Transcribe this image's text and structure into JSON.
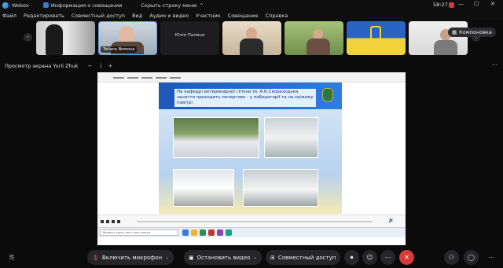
{
  "titlebar": {
    "app_name": "Webex",
    "meeting_info": "Информация о совещании",
    "hide_menu": "Скрыть строку меню",
    "timer": "58:27"
  },
  "menu": [
    "Файл",
    "Редактировать",
    "Совместный доступ",
    "Вид",
    "Аудио и видео",
    "Участник",
    "Совещание",
    "Справка"
  ],
  "participants": {
    "tiles": [
      {
        "name": ""
      },
      {
        "name": "Tetiana Nomova"
      },
      {
        "name": "Юлія Палиця"
      },
      {
        "name": ""
      },
      {
        "name": ""
      },
      {
        "name": ""
      },
      {
        "name": ""
      }
    ],
    "layout_button": "Компоновка"
  },
  "share": {
    "title": "Просмотр экрана Yurii Zhuk",
    "zoom_out": "−",
    "zoom_in": "+",
    "more": "···",
    "slide_text": "На кафедрі ветеринарної гігієни ім. А.К.Скороходька заняття проходить почергово - у лабораторії та на свіжому повітрі",
    "search_placeholder": "Введите здесь текст для поиска"
  },
  "toolbar": {
    "mic_label": "Включить микрофон",
    "video_label": "Остановить видео",
    "share_label": "Совместный доступ",
    "end_icon": "✕"
  },
  "colors": {
    "end_call": "#d93a3a",
    "background": "#0b0b0c",
    "pill": "#262628"
  }
}
